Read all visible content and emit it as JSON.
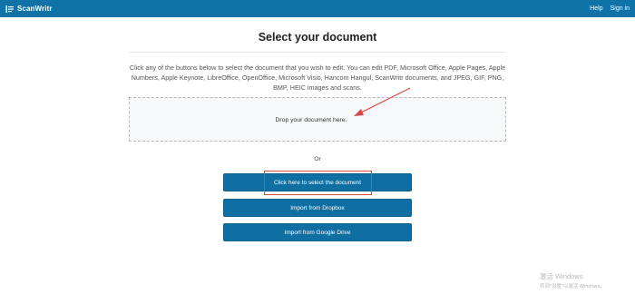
{
  "navbar": {
    "brand": "ScanWritr",
    "links": {
      "help": "Help",
      "signin": "Sign in"
    }
  },
  "main": {
    "title": "Select your document",
    "description": "Click any of the buttons below to select the document that you wish to edit. You can edit PDF, Microsoft Office, Apple Pages, Apple Numbers, Apple Keynote, LibreOffice, OpenOffice, Microsoft Visio, Hancom Hangul, ScanWritr documents, and JPEG, GIF, PNG, BMP, HEIC images and scans.",
    "dropzone_text": "Drop your document here.",
    "or_text": "Or",
    "buttons": {
      "select": "Click here to select the document",
      "dropbox": "Import from Dropbox",
      "gdrive": "Import from Google Drive"
    }
  },
  "watermark": {
    "line1": "激活 Windows",
    "line2": "转到\"设置\"以激活 Windows。"
  },
  "colors": {
    "navbar": "#0f73a8",
    "button": "#0f6fa3",
    "annotation": "#d84848"
  },
  "icons": {
    "brand": "scanwritr-logo-icon"
  }
}
